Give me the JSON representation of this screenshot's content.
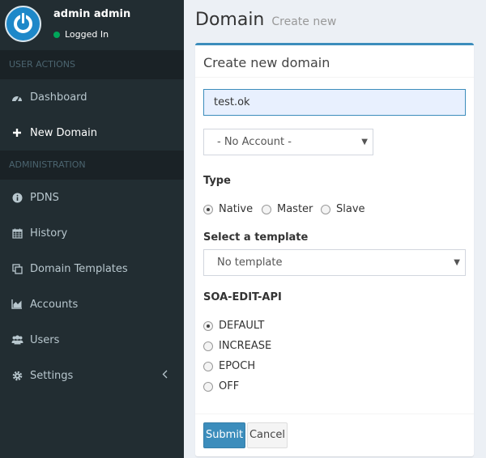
{
  "user": {
    "name": "admin admin",
    "status": "Logged In"
  },
  "sidebar": {
    "header_user_actions": "USER ACTIONS",
    "header_administration": "ADMINISTRATION",
    "items": [
      {
        "label": "Dashboard",
        "icon": "dashboard-icon"
      },
      {
        "label": "New Domain",
        "icon": "plus-icon"
      },
      {
        "label": "PDNS",
        "icon": "info-icon"
      },
      {
        "label": "History",
        "icon": "calendar-icon"
      },
      {
        "label": "Domain Templates",
        "icon": "clone-icon"
      },
      {
        "label": "Accounts",
        "icon": "chart-icon"
      },
      {
        "label": "Users",
        "icon": "users-icon"
      },
      {
        "label": "Settings",
        "icon": "gear-icon"
      }
    ]
  },
  "header": {
    "title": "Domain",
    "subtitle": "Create new"
  },
  "form": {
    "box_title": "Create new domain",
    "domain_value": "test.ok",
    "account_select": "- No Account -",
    "type_label": "Type",
    "type_options": [
      "Native",
      "Master",
      "Slave"
    ],
    "type_selected": "Native",
    "template_label": "Select a template",
    "template_select": "No template",
    "soa_label": "SOA-EDIT-API",
    "soa_options": [
      "DEFAULT",
      "INCREASE",
      "EPOCH",
      "OFF"
    ],
    "soa_selected": "DEFAULT",
    "submit_label": "Submit",
    "cancel_label": "Cancel"
  },
  "colors": {
    "sidebar_bg": "#222d32",
    "sidebar_header_bg": "#1a2226",
    "accent": "#3c8dbc",
    "status_online": "#00a65a"
  }
}
